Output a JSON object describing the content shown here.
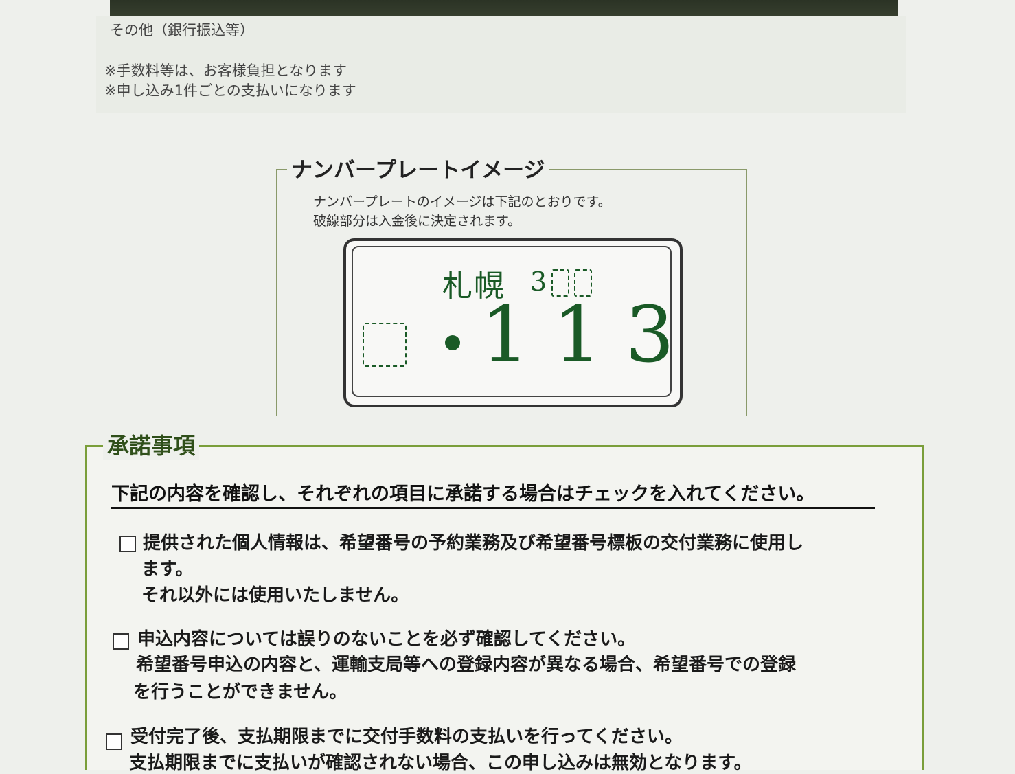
{
  "payment": {
    "other_method": "その他（銀行振込等）",
    "notes": [
      "※手数料等は、お客様負担となります",
      "※申し込み1件ごとの支払いになります"
    ]
  },
  "plate_image": {
    "title": "ナンバープレートイメージ",
    "description": [
      "ナンバープレートのイメージは下記のとおりです。",
      "破線部分は入金後に決定されます。"
    ],
    "plate": {
      "region": "札幌",
      "class_digit": "3",
      "dot": "・",
      "number": "13",
      "number_prefix": "1"
    }
  },
  "consent": {
    "title": "承諾事項",
    "instruction": "下記の内容を確認し、それぞれの項目に承諾する場合はチェックを入れてください。",
    "items": [
      {
        "lines": [
          "提供された個人情報は、希望番号の予約業務及び希望番号標板の交付業務に使用し",
          "ます。",
          "それ以外には使用いたしません。"
        ]
      },
      {
        "lines": [
          "申込内容については誤りのないことを必ず確認してください。",
          "希望番号申込の内容と、運輸支局等への登録内容が異なる場合、希望番号での登録",
          "を行うことができません。"
        ]
      },
      {
        "lines": [
          "受付完了後、支払期限までに交付手数料の支払いを行ってください。",
          "支払期限までに支払いが確認されない場合、この申し込みは無効となります。"
        ]
      }
    ]
  },
  "colors": {
    "plate_text": "#1a5a26",
    "section_border": "#7a9e3a"
  }
}
